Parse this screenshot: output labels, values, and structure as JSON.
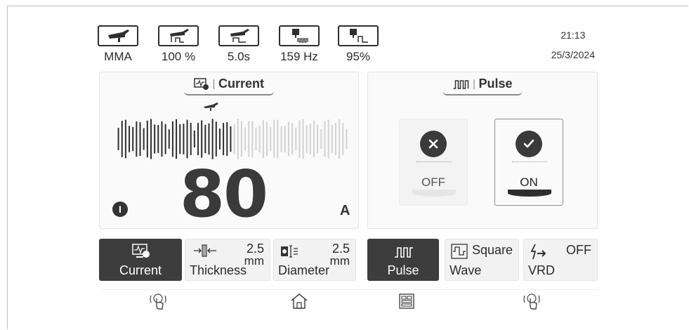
{
  "status": {
    "mode_label": "MMA",
    "percent_label": "100 %",
    "time_label": "5.0s",
    "freq_label": "159 Hz",
    "duty_label": "95%",
    "clock": "21:13",
    "date": "25/3/2024"
  },
  "current_panel": {
    "title": "Current",
    "value": "80",
    "unit": "A",
    "info_badge": "I",
    "level": 0.5
  },
  "pulse_panel": {
    "title": "Pulse",
    "off_label": "OFF",
    "on_label": "ON",
    "selected": "ON"
  },
  "buttons": {
    "current": {
      "label": "Current"
    },
    "thickness": {
      "label": "Thickness",
      "value": "2.5",
      "unit": "mm"
    },
    "diameter": {
      "label": "Diameter",
      "value": "2.5",
      "unit": "mm"
    },
    "pulse": {
      "label": "Pulse"
    },
    "wave": {
      "label": "Wave",
      "value": "Square"
    },
    "vrd": {
      "label": "VRD",
      "value": "OFF"
    }
  },
  "icons": {
    "torch": "torch-icon",
    "touch": "touch-icon",
    "home": "home-icon",
    "menu": "menu-icon",
    "check": "check-icon",
    "close": "close-icon"
  },
  "colors": {
    "active": "#3d3d3d",
    "panel": "#fafafa",
    "button": "#f2f2f2"
  }
}
